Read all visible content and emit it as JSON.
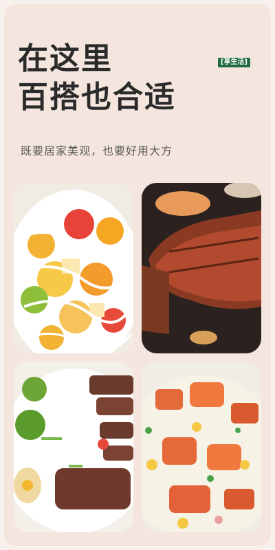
{
  "headline": {
    "line1": "在这里",
    "line2": "百搭也合适"
  },
  "tag": "[享生活]",
  "subtitle": "既要居家美观，也要好用大方",
  "photos": [
    {
      "name": "fruit-salad-photo"
    },
    {
      "name": "steak-photo"
    },
    {
      "name": "beef-broccoli-photo"
    },
    {
      "name": "fried-rice-photo"
    }
  ],
  "colors": {
    "background": "#f4e6df",
    "tag_green": "#1f6b3f",
    "text_dark": "#2a2a2a"
  }
}
